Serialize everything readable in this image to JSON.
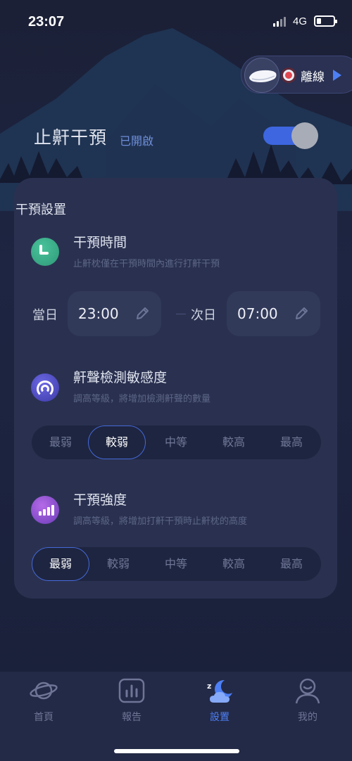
{
  "status_bar": {
    "time": "23:07",
    "network": "4G"
  },
  "device": {
    "status": "離線"
  },
  "header": {
    "title": "止鼾干預",
    "status": "已開啟",
    "toggle_on": true
  },
  "settings": {
    "title": "干預設置",
    "time_section": {
      "title": "干預時間",
      "desc": "止鼾枕僅在干預時間內進行打鼾干預",
      "start_label": "當日",
      "start_time": "23:00",
      "end_label": "次日",
      "end_time": "07:00"
    },
    "sensitivity": {
      "title": "鼾聲檢測敏感度",
      "desc": "調高等級，將增加檢測鼾聲的數量",
      "options": [
        "最弱",
        "較弱",
        "中等",
        "較高",
        "最高"
      ],
      "selected": "較弱"
    },
    "strength": {
      "title": "干預強度",
      "desc": "調高等級，將增加打鼾干預時止鼾枕的高度",
      "options": [
        "最弱",
        "較弱",
        "中等",
        "較高",
        "最高"
      ],
      "selected": "最弱"
    }
  },
  "tabs": [
    {
      "label": "首頁",
      "icon": "planet-icon"
    },
    {
      "label": "報告",
      "icon": "bar-chart-icon"
    },
    {
      "label": "設置",
      "icon": "moon-cloud-icon"
    },
    {
      "label": "我的",
      "icon": "user-icon"
    }
  ],
  "active_tab": "設置",
  "colors": {
    "accent": "#4d7ff5",
    "background": "#1a2039",
    "card": "#2a3150"
  }
}
